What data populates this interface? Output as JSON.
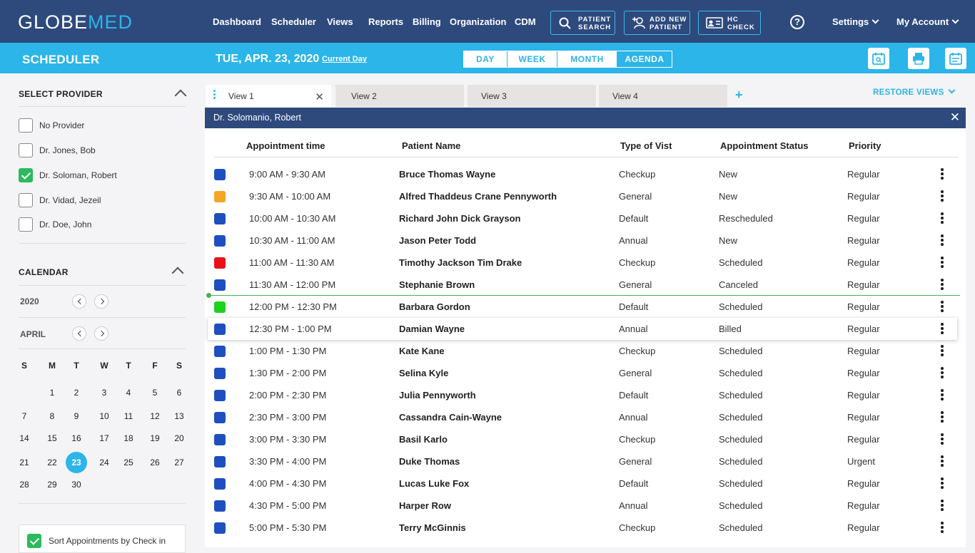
{
  "brand": {
    "logo_part1": "GLOBE",
    "logo_part2": "MED"
  },
  "nav": {
    "links": [
      "Dashboard",
      "Scheduler",
      "Views",
      "Reports",
      "Billing",
      "Organization",
      "CDM"
    ],
    "patient_search": [
      "PATIENT",
      "SEARCH"
    ],
    "add_new_patient": [
      "ADD NEW",
      "PATIENT"
    ],
    "hc_check": [
      "HC",
      "CHECK"
    ],
    "help": "?",
    "settings": "Settings",
    "my_account": "My Account"
  },
  "subbar": {
    "title": "SCHEDULER",
    "date": "TUE, APR. 23, 2020",
    "current_day": "Current Day",
    "view_modes": [
      "DAY",
      "WEEK",
      "MONTH",
      "AGENDA"
    ],
    "active_mode": "AGENDA"
  },
  "providers": {
    "title": "SELECT PROVIDER",
    "items": [
      {
        "label": "No Provider",
        "checked": false
      },
      {
        "label": "Dr. Jones, Bob",
        "checked": false
      },
      {
        "label": "Dr. Soloman, Robert",
        "checked": true
      },
      {
        "label": "Dr. Vidad, Jezeil",
        "checked": false
      },
      {
        "label": "Dr. Doe, John",
        "checked": false
      }
    ]
  },
  "calendar": {
    "title": "CALENDAR",
    "year": "2020",
    "month": "APRIL",
    "weekdays": [
      "S",
      "M",
      "T",
      "W",
      "T",
      "F",
      "S"
    ],
    "weeks": [
      [
        "",
        "1",
        "2",
        "3",
        "4",
        "5",
        "6"
      ],
      [
        "7",
        "8",
        "9",
        "10",
        "11",
        "12",
        "13"
      ],
      [
        "14",
        "15",
        "16",
        "17",
        "18",
        "19",
        "20"
      ],
      [
        "21",
        "22",
        "23",
        "24",
        "25",
        "26",
        "27"
      ],
      [
        "28",
        "29",
        "30",
        "",
        "",
        "",
        ""
      ]
    ],
    "selected_day": "23"
  },
  "sort_option": {
    "label": "Sort Appointments by Check in",
    "checked": true
  },
  "tabs": [
    "View 1",
    "View 2",
    "View 3",
    "View 4"
  ],
  "restore_views": "RESTORE VIEWS",
  "provider_bar": {
    "name": "Dr. Solomanio, Robert"
  },
  "table": {
    "headers": [
      "Appointment time",
      "Patient Name",
      "Type of Vist",
      "Appointment Status",
      "Priority"
    ],
    "rows": [
      {
        "color": "#1f4fbf",
        "time": "9:00 AM - 9:30 AM",
        "patient": "Bruce Thomas Wayne",
        "type": "Checkup",
        "status": "New",
        "priority": "Regular"
      },
      {
        "color": "#f5a623",
        "time": "9:30 AM - 10:00 AM",
        "patient": "Alfred Thaddeus Crane Pennyworth",
        "type": "General",
        "status": "New",
        "priority": "Regular"
      },
      {
        "color": "#1f4fbf",
        "time": "10:00 AM - 10:30 AM",
        "patient": "Richard John Dick Grayson",
        "type": "Default",
        "status": "Rescheduled",
        "priority": "Regular"
      },
      {
        "color": "#1f4fbf",
        "time": "10:30 AM - 11:00 AM",
        "patient": "Jason Peter Todd",
        "type": "Annual",
        "status": "New",
        "priority": "Regular"
      },
      {
        "color": "#e8111a",
        "time": "11:00 AM - 11:30 AM",
        "patient": "Timothy Jackson Tim Drake",
        "type": "Checkup",
        "status": "Scheduled",
        "priority": "Regular"
      },
      {
        "color": "#1f4fbf",
        "time": "11:30 AM - 12:00 PM",
        "patient": "Stephanie Brown",
        "type": "General",
        "status": "Canceled",
        "priority": "Regular"
      },
      {
        "color": "#1fd11f",
        "time": "12:00 PM - 12:30 PM",
        "patient": "Barbara Gordon",
        "type": "Default",
        "status": "Scheduled",
        "priority": "Regular"
      },
      {
        "color": "#1f4fbf",
        "time": "12:30 PM - 1:00 PM",
        "patient": "Damian Wayne",
        "type": "Annual",
        "status": "Billed",
        "priority": "Regular"
      },
      {
        "color": "#1f4fbf",
        "time": "1:00 PM - 1:30 PM",
        "patient": "Kate Kane",
        "type": "Checkup",
        "status": "Scheduled",
        "priority": "Regular"
      },
      {
        "color": "#1f4fbf",
        "time": "1:30 PM - 2:00 PM",
        "patient": "Selina Kyle",
        "type": "General",
        "status": "Scheduled",
        "priority": "Regular"
      },
      {
        "color": "#1f4fbf",
        "time": "2:00 PM - 2:30 PM",
        "patient": "Julia Pennyworth",
        "type": "Default",
        "status": "Scheduled",
        "priority": "Regular"
      },
      {
        "color": "#1f4fbf",
        "time": "2:30 PM - 3:00 PM",
        "patient": "Cassandra Cain-Wayne",
        "type": "Annual",
        "status": "Scheduled",
        "priority": "Regular"
      },
      {
        "color": "#1f4fbf",
        "time": "3:00 PM - 3:30 PM",
        "patient": "Basil Karlo",
        "type": "Checkup",
        "status": "Scheduled",
        "priority": "Regular"
      },
      {
        "color": "#1f4fbf",
        "time": "3:30 PM - 4:00 PM",
        "patient": "Duke Thomas",
        "type": "General",
        "status": "Scheduled",
        "priority": "Urgent"
      },
      {
        "color": "#1f4fbf",
        "time": "4:00 PM - 4:30 PM",
        "patient": "Lucas Luke Fox",
        "type": "Default",
        "status": "Scheduled",
        "priority": "Regular"
      },
      {
        "color": "#1f4fbf",
        "time": "4:30 PM - 5:00 PM",
        "patient": "Harper Row",
        "type": "Annual",
        "status": "Scheduled",
        "priority": "Regular"
      },
      {
        "color": "#1f4fbf",
        "time": "5:00 PM - 5:30 PM",
        "patient": "Terry McGinnis",
        "type": "Checkup",
        "status": "Scheduled",
        "priority": "Regular"
      }
    ]
  }
}
